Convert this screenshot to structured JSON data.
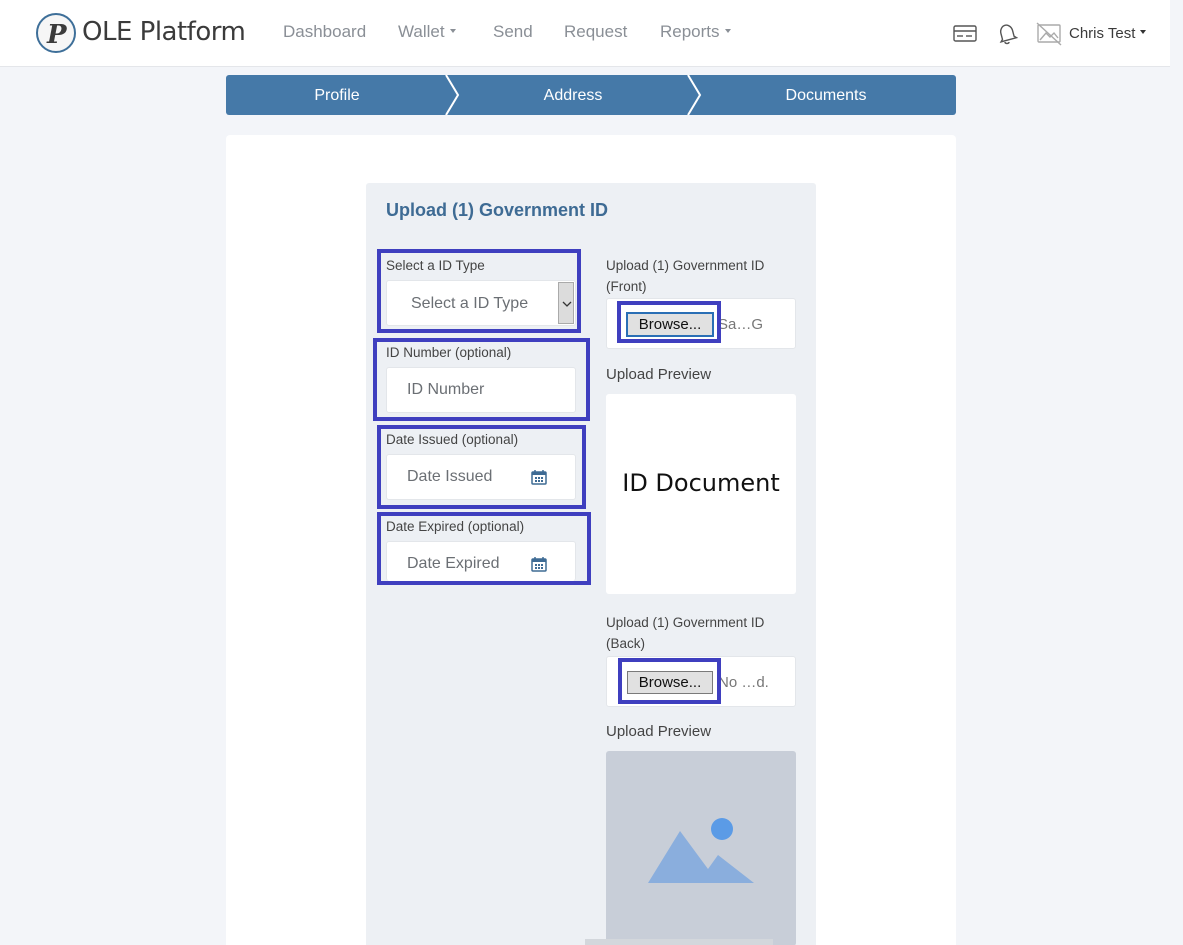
{
  "brand": {
    "name": "OLE Platform",
    "logo_letter": "P"
  },
  "nav": {
    "dashboard": "Dashboard",
    "wallet": "Wallet",
    "send": "Send",
    "request": "Request",
    "reports": "Reports"
  },
  "user": {
    "name": "Chris Test"
  },
  "steps": [
    "Profile",
    "Address",
    "Documents"
  ],
  "section_title": "Upload (1) Government ID",
  "form": {
    "id_type_label": "Select a ID Type",
    "id_type_selected": "Select a ID Type",
    "id_number_label": "ID Number (optional)",
    "id_number_placeholder": "ID Number",
    "date_issued_label": "Date Issued (optional)",
    "date_issued_placeholder": "Date Issued",
    "date_expired_label": "Date Expired (optional)",
    "date_expired_placeholder": "Date Expired"
  },
  "upload_front": {
    "label_line1": "Upload (1) Government ID",
    "label_line2": "(Front)",
    "browse_label": "Browse...",
    "file_name": "Sa…G",
    "preview_label": "Upload Preview",
    "preview_text": "ID Document"
  },
  "upload_back": {
    "label_line1": "Upload (1) Government ID",
    "label_line2": "(Back)",
    "browse_label": "Browse...",
    "file_name": "No …d.",
    "preview_label": "Upload Preview"
  },
  "colors": {
    "accent": "#4579a8",
    "highlight": "#3f3fbf",
    "title": "#3e6b94"
  }
}
